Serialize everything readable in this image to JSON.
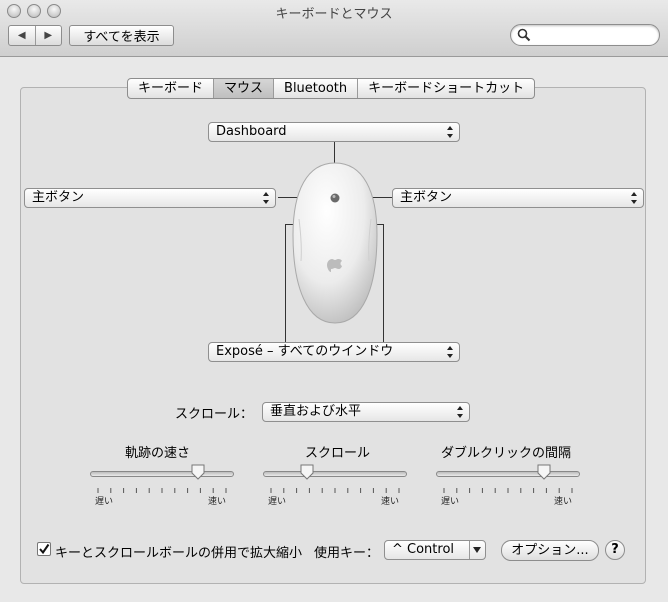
{
  "window": {
    "title": "キーボードとマウス"
  },
  "toolbar": {
    "back_icon": "◀",
    "forward_icon": "▶",
    "show_all_label": "すべてを表示",
    "search_placeholder": ""
  },
  "tabs": [
    {
      "label": "キーボード",
      "selected": false
    },
    {
      "label": "マウス",
      "selected": true
    },
    {
      "label": "Bluetooth",
      "selected": false
    },
    {
      "label": "キーボードショートカット",
      "selected": false
    }
  ],
  "mouse_buttons": {
    "top": "Dashboard",
    "left": "主ボタン",
    "right": "主ボタン",
    "bottom": "Exposé – すべてのウインドウ"
  },
  "scroll": {
    "label": "スクロール：",
    "value": "垂直および水平"
  },
  "sliders": [
    {
      "label": "軌跡の速さ",
      "min_label": "遅い",
      "max_label": "速い",
      "value_fraction": 0.76
    },
    {
      "label": "スクロール",
      "min_label": "遅い",
      "max_label": "速い",
      "value_fraction": 0.31
    },
    {
      "label": "ダブルクリックの間隔",
      "min_label": "遅い",
      "max_label": "速い",
      "value_fraction": 0.76
    }
  ],
  "zoom": {
    "checkbox_label": "キーとスクロールボールの併用で拡大縮小",
    "checked": true,
    "modifier_label": "使用キー：",
    "modifier_value": "^ Control"
  },
  "buttons": {
    "options_label": "オプション...",
    "help_label": "?"
  }
}
